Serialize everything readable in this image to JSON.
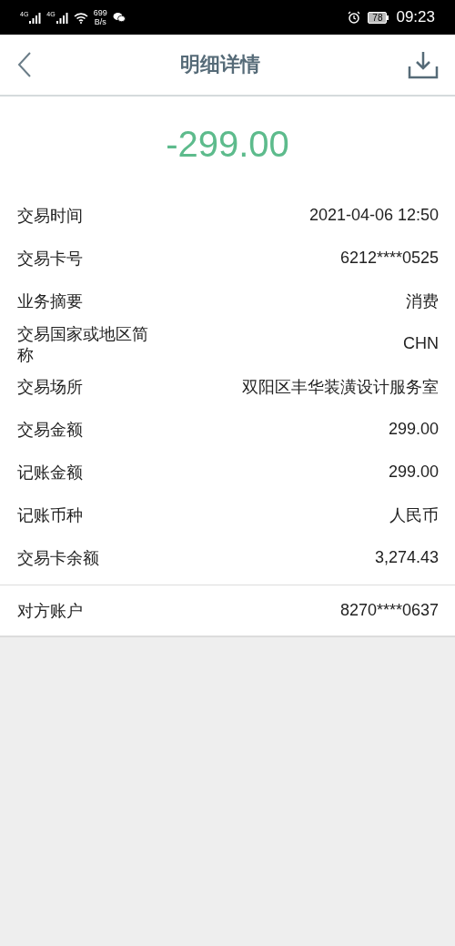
{
  "status_bar": {
    "signal_1": "4G",
    "signal_2": "4G",
    "net_speed": "699",
    "net_unit": "B/s",
    "battery": "78",
    "time": "09:23"
  },
  "header": {
    "title": "明细详情"
  },
  "amount": "-299.00",
  "groups": [
    {
      "rows": [
        {
          "label": "交易时间",
          "value": "2021-04-06 12:50"
        },
        {
          "label": "交易卡号",
          "value": "6212****0525"
        },
        {
          "label": "业务摘要",
          "value": "消费"
        },
        {
          "label": "交易国家或地区简称",
          "value": "CHN"
        },
        {
          "label": "交易场所",
          "value": "双阳区丰华装潢设计服务室"
        },
        {
          "label": "交易金额",
          "value": "299.00"
        },
        {
          "label": "记账金额",
          "value": "299.00"
        },
        {
          "label": "记账币种",
          "value": "人民币"
        },
        {
          "label": "交易卡余额",
          "value": "3,274.43"
        }
      ]
    },
    {
      "rows": [
        {
          "label": "对方账户",
          "value": "8270****0637"
        }
      ]
    }
  ]
}
